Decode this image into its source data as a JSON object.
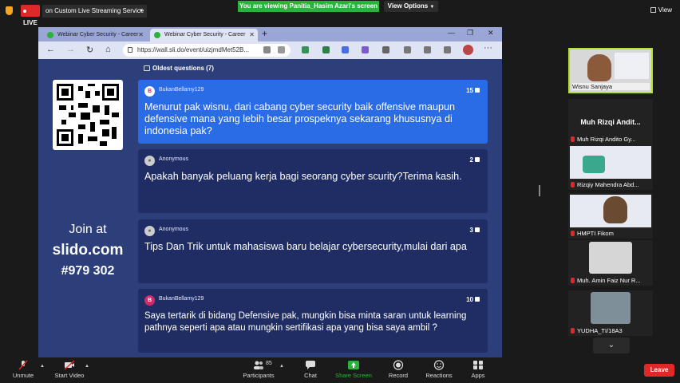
{
  "zoom": {
    "live_label": "LIVE",
    "stream_label": "on Custom Live Streaming Service",
    "viewing_banner": "You are viewing Panitia_Hasim Azari's screen",
    "view_options": "View Options",
    "view_button": "View",
    "accent_green": "#2bb13c",
    "live_red": "#e02828"
  },
  "browser": {
    "tabs": [
      {
        "label": "Webinar Cyber Security - Career"
      },
      {
        "label": "Webinar Cyber Security - Career"
      }
    ],
    "url": "https://wall.sli.do/event/uizjmdMet52B..."
  },
  "slido": {
    "oldest_label": "Oldest questions (7)",
    "join_line1": "Join at",
    "join_line2": "slido.com",
    "join_line3": "#979 302",
    "questions": [
      {
        "author": "BukanBellamy129",
        "avatar": "B",
        "votes": "15",
        "text": "Menurut pak wisnu, dari cabang cyber security baik offensive maupun defensive mana yang lebih besar prospeknya sekarang khususnya di indonesia pak?"
      },
      {
        "author": "Anonymous",
        "avatar": "",
        "votes": "2",
        "text": "Apakah banyak peluang kerja bagi seorang cyber scurity?Terima kasih."
      },
      {
        "author": "Anonymous",
        "avatar": "",
        "votes": "3",
        "text": "Tips Dan Trik untuk mahasiswa baru belajar cybersecurity,mulai dari apa"
      },
      {
        "author": "BukanBellamy129",
        "avatar": "B",
        "votes": "10",
        "text": "Saya tertarik di bidang Defensive pak, mungkin bisa minta saran untuk learning pathnya seperti apa atau mungkin sertifikasi apa yang bisa saya ambil ?"
      }
    ]
  },
  "participants": [
    {
      "name": "Wisnu Sanjaya"
    },
    {
      "name": "Muh Rizqi Andit...",
      "sub": "Muh Rizqi Andito Gy..."
    },
    {
      "name": "Rizqiy Mahendra Abd..."
    },
    {
      "name": "HMPTI Fikom"
    },
    {
      "name": "Muh. Amin Faiz Nur R..."
    },
    {
      "name": "YUDHA_TI/18A3"
    }
  ],
  "toolbar": {
    "unmute": "Unmute",
    "start_video": "Start Video",
    "participants": "Participants",
    "participants_count": "85",
    "chat": "Chat",
    "share_screen": "Share Screen",
    "record": "Record",
    "reactions": "Reactions",
    "apps": "Apps",
    "leave": "Leave"
  }
}
